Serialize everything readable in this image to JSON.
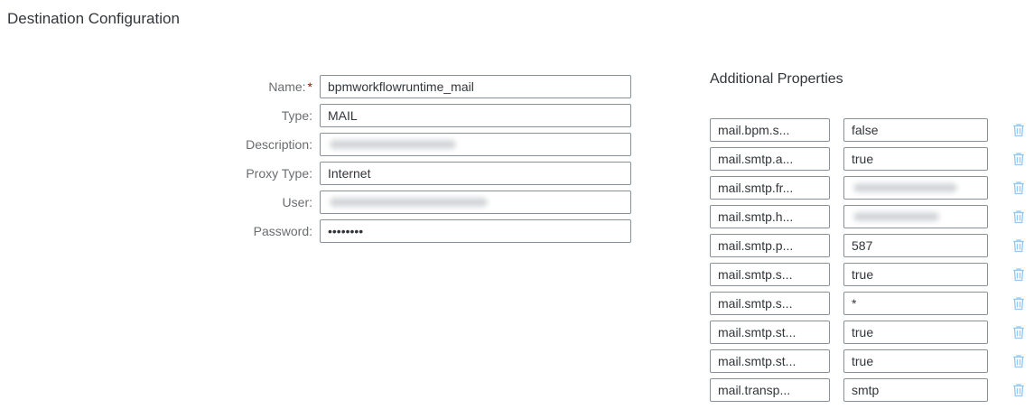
{
  "page": {
    "title": "Destination Configuration"
  },
  "form": {
    "required_marker": "*",
    "fields": [
      {
        "label": "Name:",
        "value": "bpmworkflowruntime_mail",
        "required": true
      },
      {
        "label": "Type:",
        "value": "MAIL"
      },
      {
        "label": "Description:",
        "value": "",
        "obscured": true
      },
      {
        "label": "Proxy Type:",
        "value": "Internet"
      },
      {
        "label": "User:",
        "value": "",
        "obscured": true
      },
      {
        "label": "Password:",
        "value": "••••••••"
      }
    ]
  },
  "additional_properties": {
    "title": "Additional Properties",
    "delete_icon": "trash-icon",
    "icon_color": "#91c8f6",
    "rows": [
      {
        "key": "mail.bpm.s...",
        "value": "false"
      },
      {
        "key": "mail.smtp.a...",
        "value": "true"
      },
      {
        "key": "mail.smtp.fr...",
        "value": "",
        "obscured": true
      },
      {
        "key": "mail.smtp.h...",
        "value": "",
        "obscured": true
      },
      {
        "key": "mail.smtp.p...",
        "value": "587"
      },
      {
        "key": "mail.smtp.s...",
        "value": "true"
      },
      {
        "key": "mail.smtp.s...",
        "value": "*"
      },
      {
        "key": "mail.smtp.st...",
        "value": "true"
      },
      {
        "key": "mail.smtp.st...",
        "value": "true"
      },
      {
        "key": "mail.transp...",
        "value": "smtp"
      }
    ]
  }
}
